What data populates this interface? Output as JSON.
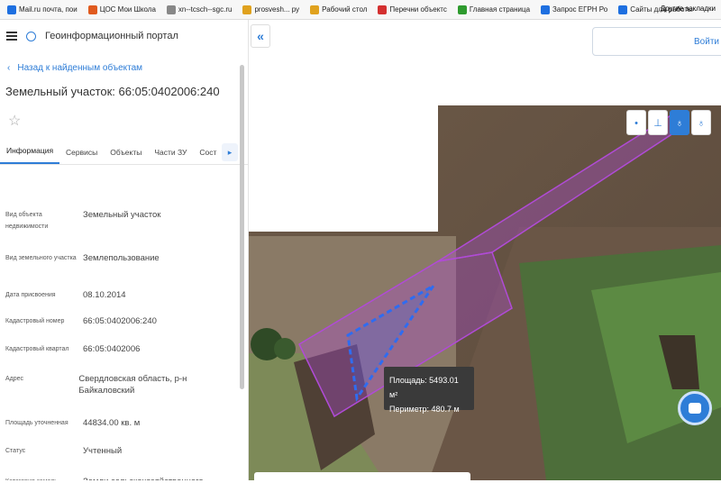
{
  "bookmarks": [
    {
      "label": "Mail.ru почта, пои",
      "color": "#1e6fe0"
    },
    {
      "label": "ЦОС Мои Школа",
      "color": "#e05a1e"
    },
    {
      "label": "xn--tcsch--sgc.ru",
      "color": "#888888"
    },
    {
      "label": "prosvesh... ру",
      "color": "#e0a21e"
    },
    {
      "label": "Рабочий стол",
      "color": "#e0a21e"
    },
    {
      "label": "Перечни объектс",
      "color": "#d43030"
    },
    {
      "label": "Главная страница",
      "color": "#2e9b2e"
    },
    {
      "label": "Запрос ЕГРН Ро",
      "color": "#1e6fe0"
    },
    {
      "label": "Сайты для работы",
      "color": "#1e6fe0"
    }
  ],
  "bookmarks_other": "Другие закладки",
  "portal": {
    "title": "Геоинформационный портал"
  },
  "back_link": "Назад к найденным объектам",
  "object_title": "Земельный участок: 66:05:0402006:240",
  "tabs": [
    "Информация",
    "Сервисы",
    "Объекты",
    "Части ЗУ",
    "Сост"
  ],
  "tab_next": "▸",
  "fields": [
    {
      "key": "Вид объекта недвижимости",
      "value": "Земельный участок"
    },
    {
      "key": "Вид земельного участка",
      "value": "Землепользование"
    },
    {
      "key": "Дата присвоения",
      "value": "08.10.2014"
    },
    {
      "key": "Кадастровый номер",
      "value": "66:05:0402006:240"
    },
    {
      "key": "Кадастровый квартал",
      "value": "66:05:0402006"
    },
    {
      "key": "Адрес",
      "value": "Свердловская область, р-н Байкаловский"
    },
    {
      "key": "Площадь уточненная",
      "value": "44834.00 кв. м"
    },
    {
      "key": "Статус",
      "value": "Учтенный"
    },
    {
      "key": "Категория земель",
      "value": "Земли сельскохозяйственного"
    }
  ],
  "map": {
    "collapse_icon": "«",
    "search_label": "Войти",
    "tools": [
      "•",
      "⊥",
      "♁",
      "♁"
    ],
    "tooltip": {
      "area": "Площадь: 5493.01 м²",
      "perimeter": "Периметр: 480.7 м"
    },
    "parcel_color": "#b04bd6",
    "measure_color": "#2f6cf0"
  }
}
